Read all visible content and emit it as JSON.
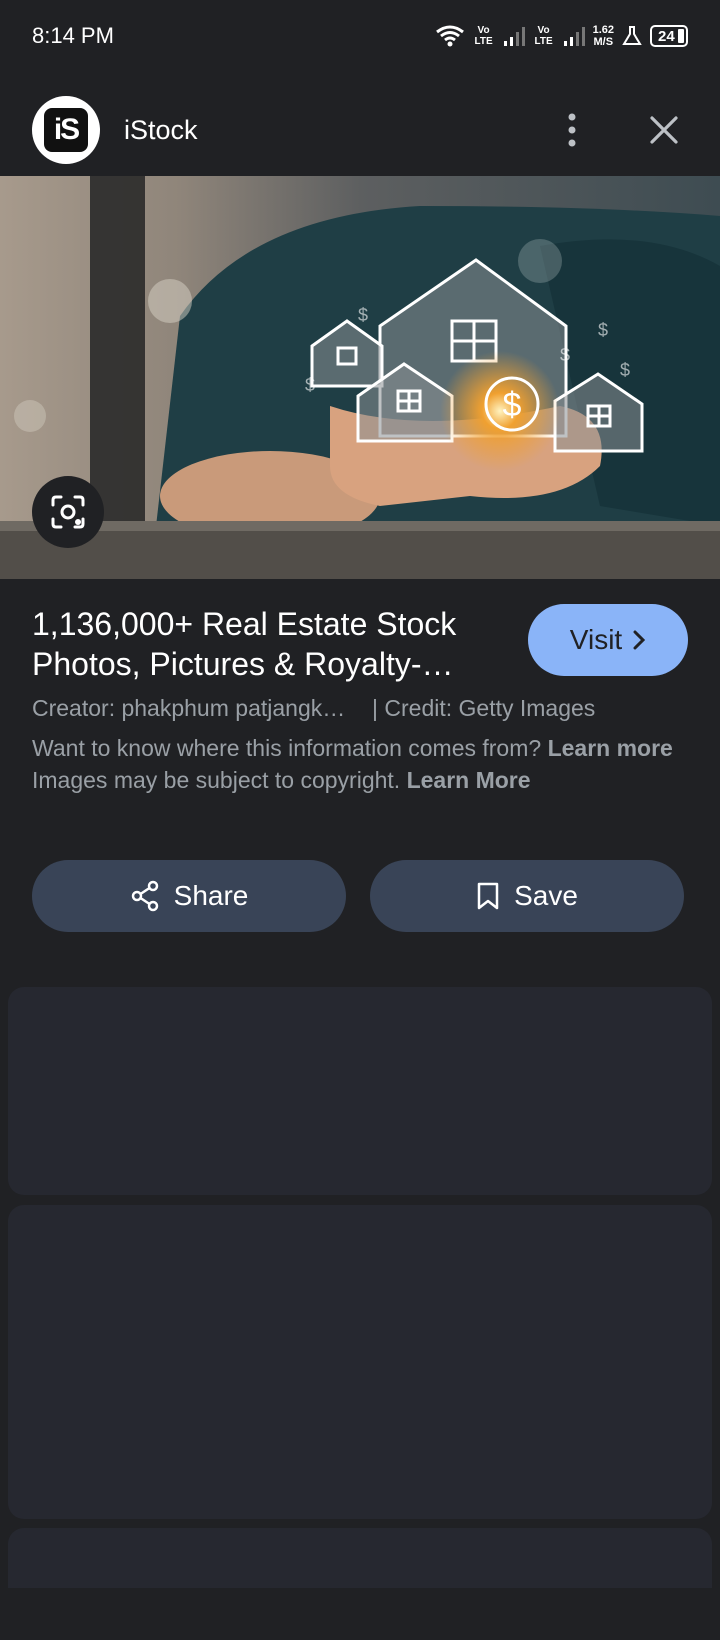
{
  "status_bar": {
    "time": "8:14 PM",
    "volte_1": "Vo LTE",
    "volte_2": "Vo LTE",
    "speed_value": "1.62",
    "speed_unit": "M/S",
    "battery": "24"
  },
  "header": {
    "logo_text": "iS",
    "site_name": "iStock",
    "more_icon": "more-vert-icon",
    "close_icon": "close-icon"
  },
  "result": {
    "title": "1,136,000+ Real Estate Stock Photos, Pictures & Royalty-…",
    "visit_label": "Visit",
    "creator": "Creator: phakphum patjangk…",
    "credit": "| Credit: Getty Images",
    "info_text": "Want to know where this information comes from?",
    "info_link": "Learn more",
    "copyright_text": "Images may be subject to copyright.",
    "copyright_link": "Learn More"
  },
  "actions": {
    "share_label": "Share",
    "save_label": "Save"
  },
  "colors": {
    "background": "#202124",
    "accent": "#8ab4f8",
    "button_bg": "#394457",
    "card_bg": "#262830"
  }
}
